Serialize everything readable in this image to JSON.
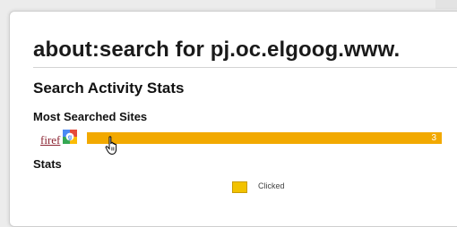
{
  "page": {
    "title": "about:search for pj.oc.elgoog.www."
  },
  "sections": {
    "activity_heading": "Search Activity Stats",
    "most_searched_heading": "Most Searched Sites",
    "stats_heading": "Stats"
  },
  "most_searched_sites": [
    {
      "label": "firef",
      "icon": "google-icon",
      "value": "3",
      "fill_fraction": 1.0
    }
  ],
  "legend": {
    "label": "Clicked"
  },
  "colors": {
    "bar": "#f2a900",
    "legend_swatch": "#f2c200",
    "link": "#8b2331"
  }
}
